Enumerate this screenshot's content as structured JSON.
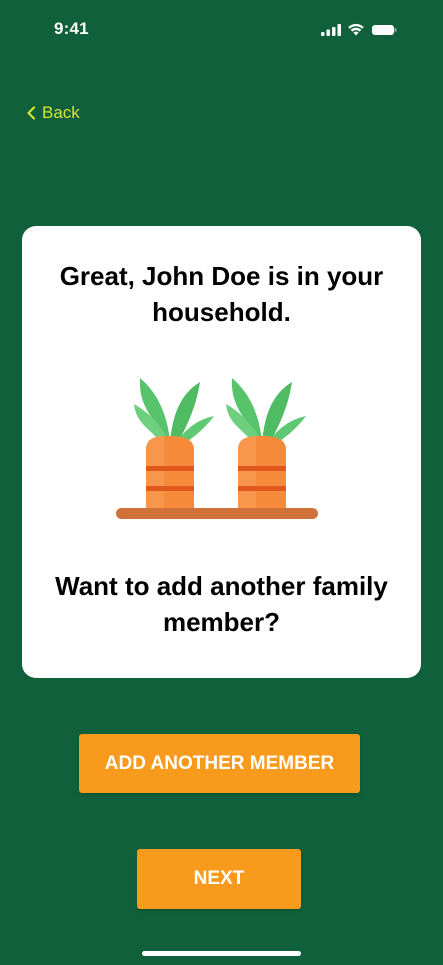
{
  "status_bar": {
    "time": "9:41"
  },
  "nav": {
    "back_label": "Back"
  },
  "card": {
    "title": "Great, John Doe is in your household.",
    "question": "Want to add another family member?"
  },
  "buttons": {
    "add_member_label": "ADD ANOTHER MEMBER",
    "next_label": "NEXT"
  },
  "colors": {
    "background": "#10603b",
    "card": "#ffffff",
    "accent_button": "#f89a1c",
    "back_link": "#d7e23a",
    "carrot_body": "#f58a3a",
    "carrot_stripe": "#e2571c",
    "carrot_leaves": "#57c46b",
    "shelf": "#d0713a"
  },
  "icons": {
    "back": "chevron-left-icon",
    "signal": "cellular-signal-icon",
    "wifi": "wifi-icon",
    "battery": "battery-icon",
    "illustration": "carrots-illustration"
  }
}
